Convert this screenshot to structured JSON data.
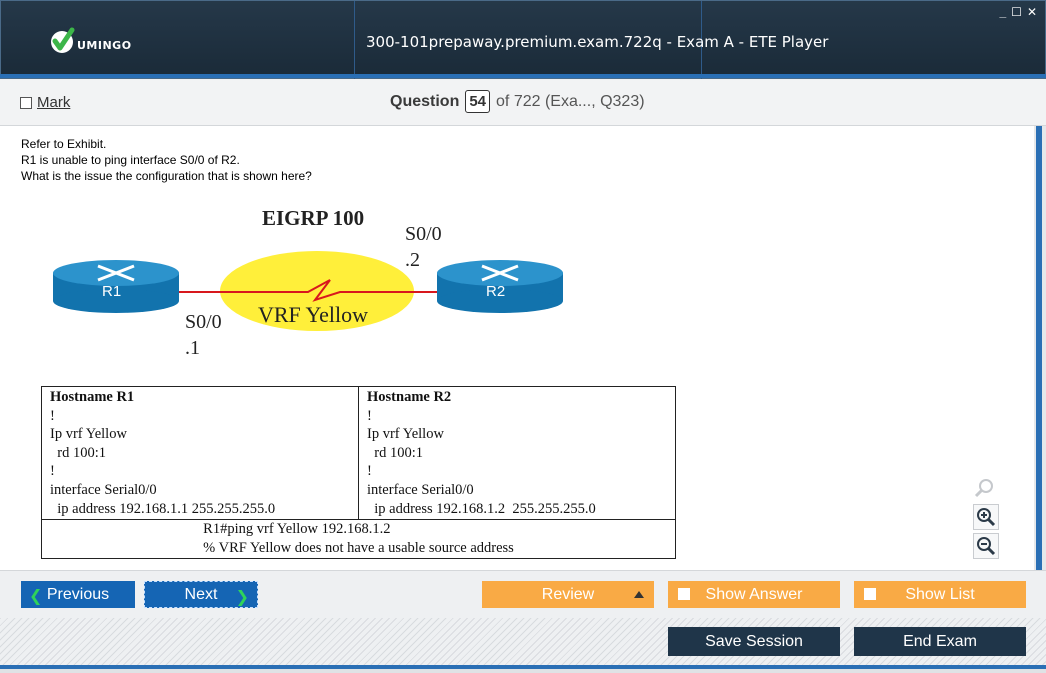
{
  "window": {
    "title": "300-101prepaway.premium.exam.722q - Exam A - ETE Player",
    "logo_text": "UMINGO",
    "controls": [
      "_",
      "☐",
      "✕"
    ]
  },
  "question_bar": {
    "mark_label": "Mark",
    "question_word": "Question",
    "question_number": "54",
    "of_text": "of 722 (Exa..., Q323)"
  },
  "question": {
    "lines": [
      "Refer to Exhibit.",
      "R1 is unable to ping interface S0/0 of R2.",
      "What is the issue the configuration that is shown here?"
    ]
  },
  "exhibit": {
    "title": "EIGRP 100",
    "r1_label": "R1",
    "r2_label": "R2",
    "r1_interface": "S0/0",
    "r1_address": ".1",
    "r2_interface": "S0/0",
    "r2_address": ".2",
    "vrf_label": "VRF Yellow",
    "vrf_color": "#ffef3a",
    "link_color": "#d8181d",
    "router_color": "#1a7fb8",
    "table": {
      "r1_header": "Hostname R1",
      "r1_lines": [
        "!",
        "Ip vrf Yellow",
        "  rd 100:1",
        "!",
        "interface Serial0/0",
        "  ip address 192.168.1.1 255.255.255.0"
      ],
      "r2_header": "Hostname R2",
      "r2_lines": [
        "!",
        "Ip vrf Yellow",
        "  rd 100:1",
        "!",
        "interface Serial0/0",
        "  ip address 192.168.1.2  255.255.255.0"
      ],
      "ping_command": "R1#ping vrf Yellow 192.168.1.2",
      "ping_result": "% VRF Yellow does not have a usable source address"
    }
  },
  "zoom_icons": [
    "search-icon",
    "zoom-in-icon",
    "zoom-out-icon"
  ],
  "buttons": {
    "previous": "Previous",
    "next": "Next",
    "review": "Review",
    "show_answer": "Show Answer",
    "show_list": "Show List",
    "save_session": "Save Session",
    "end_exam": "End Exam"
  },
  "colors": {
    "titlebar": "#1f3040",
    "accent_blue": "#1565b4",
    "orange": "#f9aa45",
    "dark_button": "#1f3549",
    "chevron_green": "#2fd35a"
  }
}
